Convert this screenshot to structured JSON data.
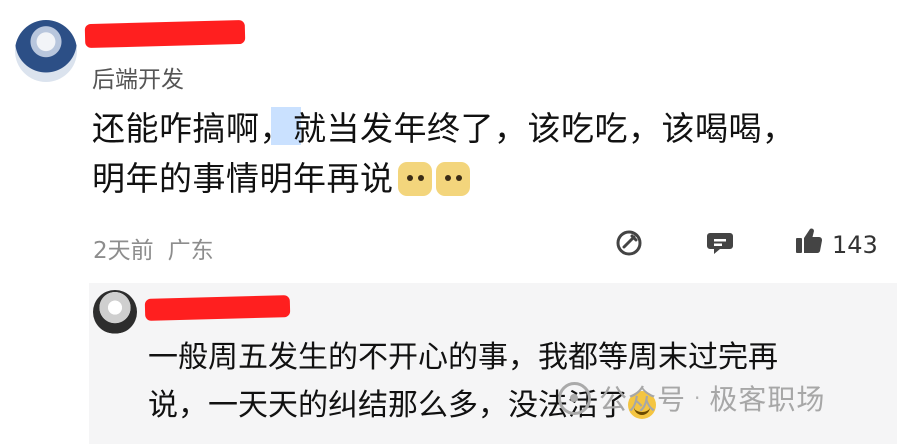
{
  "comment": {
    "role": "后端开发",
    "text_line1": "还能咋搞啊，就当发年终了，该吃吃，该喝喝，",
    "text_line2": "明年的事情明年再说",
    "time": "2天前",
    "location": "广东",
    "like_count": "143",
    "emoji": [
      "doge",
      "doge"
    ]
  },
  "reply": {
    "text_line1": "一般周五发生的不开心的事，我都等周末过完再",
    "text_line2": "说，一天天的纠结那么多，没法活了",
    "emoji": "laugh-cry"
  },
  "watermark": {
    "source": "公众号",
    "separator": "·",
    "brand": "极客职场"
  },
  "colors": {
    "redaction": "#ff1f1f",
    "reply_bg": "#f5f5f6",
    "meta_text": "#8d8d8d"
  },
  "icons": [
    "edit-icon",
    "comment-icon",
    "like-icon",
    "watermark-logo-icon"
  ]
}
